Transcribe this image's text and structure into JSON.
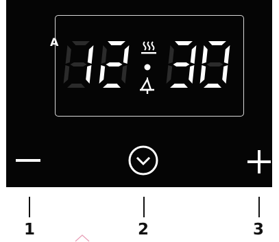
{
  "display": {
    "mode_indicator": "A",
    "time_digits": [
      "1",
      "2",
      "3",
      "0"
    ],
    "icons": [
      "heating-icon",
      "bell-icon"
    ]
  },
  "controls": {
    "minus": {
      "label": "−",
      "icon": "minus-icon"
    },
    "clock": {
      "icon": "clock-icon"
    },
    "plus": {
      "label": "+",
      "icon": "plus-icon"
    }
  },
  "annotations": [
    "1",
    "2",
    "3"
  ],
  "colors": {
    "panel": "#050505",
    "lit": "#ffffff",
    "unlit": "#2b2b2b",
    "frame": "#d9d9d9"
  }
}
